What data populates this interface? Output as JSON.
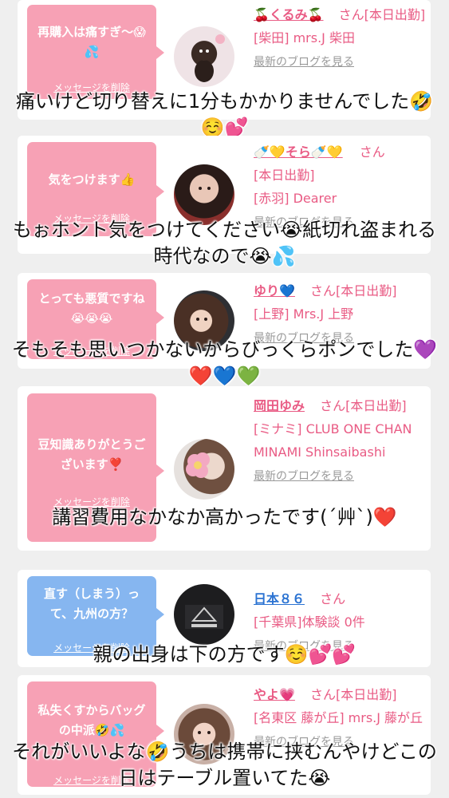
{
  "posts": [
    {
      "bubble": "再購入は痛すぎ〜😱💦",
      "delete_label": "メッセージを削除",
      "name": "🍒くるみ🍒",
      "san": "さん",
      "status": "[本日出勤]",
      "shop": "[柴田] mrs.J 柴田",
      "blog_link": "最新のブログを見る",
      "caption": "痛いけど切り替えに1分もかかりませんでした🤣☺️💕"
    },
    {
      "bubble": "気をつけます👍",
      "delete_label": "メッセージを削除",
      "name": "🍼💛そら🍼💛",
      "san": "さん",
      "status": "[本日出勤]",
      "shop": "[赤羽] Dearer",
      "blog_link": "最新のブログを見る",
      "caption": "もぉホント気をつけてください😭紙切れ盗まれる時代なので😭💦"
    },
    {
      "bubble": "とっても悪質ですね😭😭😭",
      "delete_label": "メッセージを削除",
      "name": "ゆり💙",
      "san": "さん",
      "status": "[本日出勤]",
      "shop": "[上野] Mrs.J 上野",
      "blog_link": "最新のブログを見る",
      "caption": "そもそも思いつかないからびっくらポンでした💜❤️💙💚"
    },
    {
      "bubble": "豆知識ありがとうございます❣️",
      "delete_label": "メッセージを削除",
      "name": "岡田ゆみ",
      "san": "さん",
      "status": "[本日出勤]",
      "shop": "[ミナミ] CLUB ONE CHAN MINAMI Shinsaibashi",
      "blog_link": "最新のブログを見る",
      "caption": "講習費用なかなか高かったです(´艸`)❤️"
    },
    {
      "bubble": "直す（しまう）って、九州の方？",
      "delete_label": "メッセージを削除",
      "name": "日本８６",
      "san": "さん",
      "status": "",
      "shop": "[千葉県]体験談 0件",
      "blog_link": "最新のブログを見る",
      "caption": "親の出身は下の方です☺️💕💕"
    },
    {
      "bubble": "私失くすからバッグの中派🤣💦",
      "delete_label": "メッセージを削除",
      "name": "やよ💗",
      "san": "さん",
      "status": "[本日出勤]",
      "shop": "[名東区 藤が丘] mrs.J 藤が丘",
      "blog_link": "最新のブログを見る",
      "caption": "それがいいよな🤣うちは携帯に挟むんやけどこの日はテーブル置いてた😭"
    }
  ],
  "colors": {
    "accent_pink": "#e95b84",
    "bubble_pink": "#f7a1b5",
    "bubble_blue": "#86b6f0",
    "member_blue": "#2b73d2"
  },
  "icons": [
    "avatar-photo"
  ]
}
